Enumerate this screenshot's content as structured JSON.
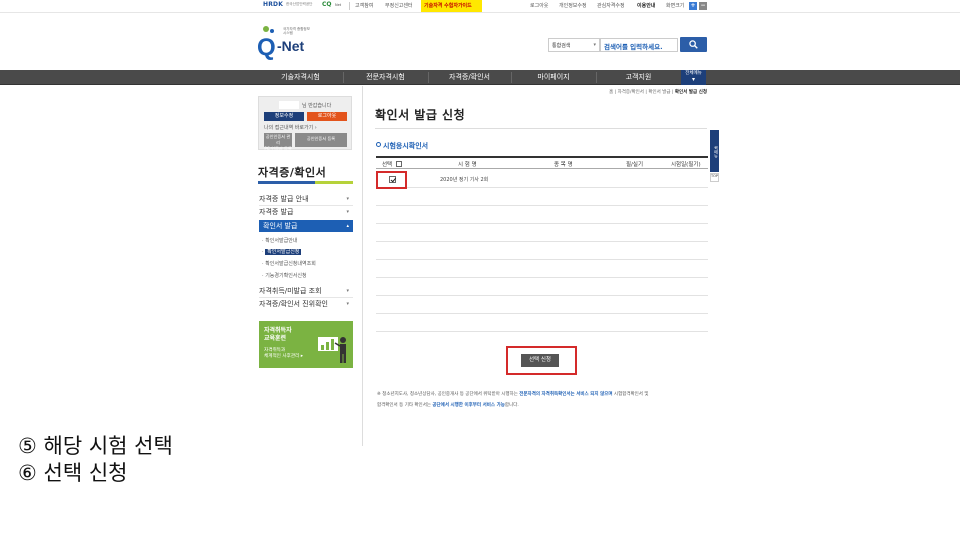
{
  "topbar": {
    "hrdk": "HRDK",
    "hrdk_sub": "한국산업인력공단",
    "cqnet": "CQ",
    "cqnet_sub": "Net",
    "links": [
      "고객참여",
      "부정신고센터"
    ],
    "highlight": "기술자격 수험자가이드",
    "right_links": [
      "로그아웃",
      "개인정보수정",
      "관심자격수정",
      "이용안내",
      "화면크기"
    ],
    "zoom_in": "+",
    "zoom_out": "−"
  },
  "logo": {
    "caption_line1": "국가자격 종합정보",
    "caption_line2": "시스템",
    "q": "Q",
    "net": "-Net"
  },
  "search": {
    "category": "통합검색",
    "placeholder": "검색어를 입력하세요."
  },
  "gnb": {
    "items": [
      "기술자격시험",
      "전문자격시험",
      "자격증/확인서",
      "마이페이지",
      "고객지원"
    ],
    "all_menu": "전체메뉴"
  },
  "login_box": {
    "greeting": "님 반갑습니다",
    "edit_info": "정보수정",
    "logout": "로그아웃",
    "history": "나의 접근내역 바로가기 ›",
    "cert_register": "공인인증서 관리",
    "cert_register2": "PC 인증서 등록",
    "cert_login": "공인인증서 등록"
  },
  "sidebar": {
    "title": "자격증/확인서",
    "menus": [
      {
        "label": "자격증 발급 안내"
      },
      {
        "label": "자격증 발급"
      },
      {
        "label": "확인서 발급"
      }
    ],
    "submenus": [
      "확인서발급안내",
      "확인서발급신청",
      "확인서발급신청내역조회",
      "기능경기확인서신청"
    ],
    "menus2": [
      {
        "label": "자격취득/미발급 조회"
      },
      {
        "label": "자격증/확인서 진위확인"
      }
    ],
    "banner": {
      "line1": "자격취득자",
      "line2": "교육훈련",
      "line3": "자격취득과",
      "line4": "체계적인 사후관리"
    }
  },
  "breadcrumb": {
    "home": "홈",
    "path1": "자격증/확인서",
    "path2": "확인서 발급",
    "current": "확인서 발급 신청"
  },
  "main": {
    "title": "확인서 발급 신청",
    "section_title": "시험응시확인서",
    "table": {
      "headers": [
        "선택",
        "시 험 명",
        "종 목 명",
        "필/실기",
        "시험일(필기)"
      ],
      "rows": [
        {
          "exam": "2020년 정기 기사 2회",
          "item": "",
          "type": "",
          "date": "",
          "checked": true
        }
      ]
    },
    "apply_button": "선택 신청",
    "note1_pre": "※ 청소년지도사, 청소년상담사, 공인중개사 등 공단에서 위탁받아 시행하는 ",
    "note1_bold": "전문자격의 자격취득확인서는 서비스 되지 않으며",
    "note1_post": " 시험합격확인서 및",
    "note2_pre": "합격확인서 등 기타 확인서는 ",
    "note2_bold": "공단에서 시행한 이후부터 서비스 가능",
    "note2_post": "합니다."
  },
  "quick": {
    "label": "퀵메뉴",
    "top": "TOP"
  },
  "steps": [
    "⑤ 해당 시험 선택",
    "⑥ 선택 신청"
  ],
  "colors": {
    "brand_blue": "#1d5fb4",
    "navy": "#1d3f7a",
    "gnb_bg": "#4a4a4a",
    "highlight_red": "#d42a2a",
    "banner_green": "#7bb342"
  }
}
